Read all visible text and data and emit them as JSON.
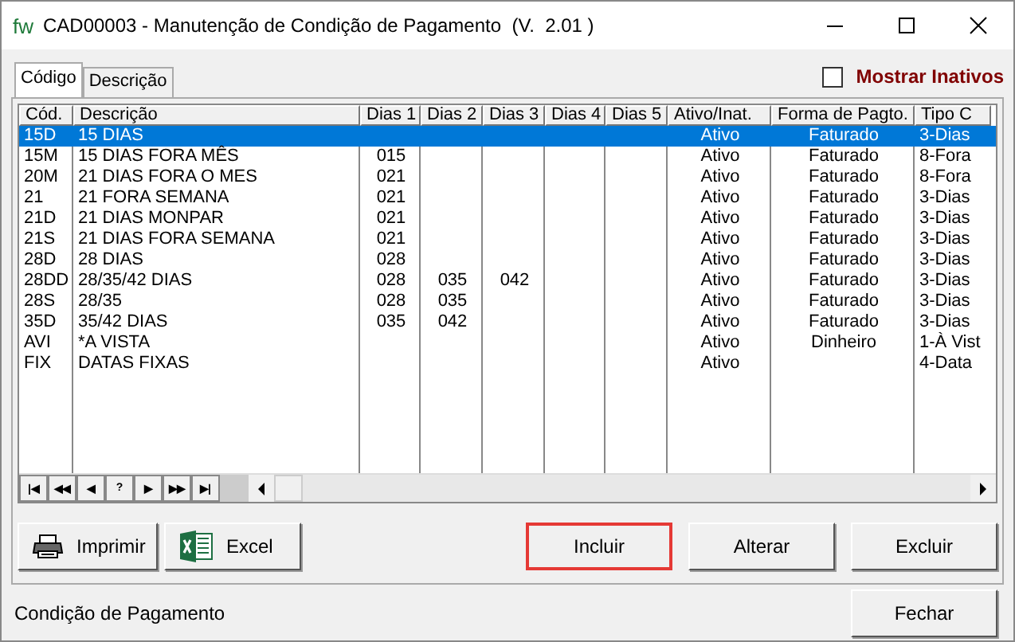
{
  "window": {
    "logo": "fw",
    "title": "CAD00003 - Manutenção de Condição de Pagamento  (V.  2.01 )"
  },
  "tabs": [
    {
      "label": "Código",
      "selected": true
    },
    {
      "label": "Descrição",
      "selected": false
    }
  ],
  "show_inactive": {
    "label": "Mostrar Inativos",
    "checked": false
  },
  "table": {
    "columns": [
      "Cód.",
      "Descrição",
      "Dias 1",
      "Dias 2",
      "Dias 3",
      "Dias 4",
      "Dias 5",
      "Ativo/Inat.",
      "Forma de Pagto.",
      "Tipo C"
    ],
    "rows": [
      {
        "selected": true,
        "cells": [
          "15D",
          "15 DIAS",
          "",
          "",
          "",
          "",
          "",
          "Ativo",
          "Faturado",
          "3-Dias"
        ]
      },
      {
        "selected": false,
        "cells": [
          "15M",
          "15 DIAS FORA MÊS",
          "015",
          "",
          "",
          "",
          "",
          "Ativo",
          "Faturado",
          "8-Fora"
        ]
      },
      {
        "selected": false,
        "cells": [
          "20M",
          "21 DIAS FORA O MES",
          "021",
          "",
          "",
          "",
          "",
          "Ativo",
          "Faturado",
          "8-Fora"
        ]
      },
      {
        "selected": false,
        "cells": [
          "21",
          "21 FORA SEMANA",
          "021",
          "",
          "",
          "",
          "",
          "Ativo",
          "Faturado",
          "3-Dias"
        ]
      },
      {
        "selected": false,
        "cells": [
          "21D",
          "21 DIAS MONPAR",
          "021",
          "",
          "",
          "",
          "",
          "Ativo",
          "Faturado",
          "3-Dias"
        ]
      },
      {
        "selected": false,
        "cells": [
          "21S",
          "21 DIAS FORA SEMANA",
          "021",
          "",
          "",
          "",
          "",
          "Ativo",
          "Faturado",
          "3-Dias"
        ]
      },
      {
        "selected": false,
        "cells": [
          "28D",
          "28 DIAS",
          "028",
          "",
          "",
          "",
          "",
          "Ativo",
          "Faturado",
          "3-Dias"
        ]
      },
      {
        "selected": false,
        "cells": [
          "28DD",
          "28/35/42 DIAS",
          "028",
          "035",
          "042",
          "",
          "",
          "Ativo",
          "Faturado",
          "3-Dias"
        ]
      },
      {
        "selected": false,
        "cells": [
          "28S",
          "28/35",
          "028",
          "035",
          "",
          "",
          "",
          "Ativo",
          "Faturado",
          "3-Dias"
        ]
      },
      {
        "selected": false,
        "cells": [
          "35D",
          "35/42 DIAS",
          "035",
          "042",
          "",
          "",
          "",
          "Ativo",
          "Faturado",
          "3-Dias"
        ]
      },
      {
        "selected": false,
        "cells": [
          "AVI",
          "*A VISTA",
          "",
          "",
          "",
          "",
          "",
          "Ativo",
          "Dinheiro",
          "1-À Vist"
        ]
      },
      {
        "selected": false,
        "cells": [
          "FIX",
          "DATAS FIXAS",
          "",
          "",
          "",
          "",
          "",
          "Ativo",
          "",
          "4-Data"
        ]
      }
    ]
  },
  "navigator": [
    "|◀",
    "◀◀",
    "◀",
    "?",
    "▶",
    "▶▶",
    "▶|"
  ],
  "buttons": [
    {
      "kind": "print",
      "label": "Imprimir",
      "highlighted": false
    },
    {
      "kind": "excel",
      "label": "Excel",
      "highlighted": false
    },
    {
      "kind": "plain",
      "label": "Incluir",
      "highlighted": true
    },
    {
      "kind": "plain",
      "label": "Alterar",
      "highlighted": false
    },
    {
      "kind": "plain",
      "label": "Excluir",
      "highlighted": false
    }
  ],
  "status_bar": {
    "text": "Condição de Pagamento",
    "close_button": "Fechar"
  }
}
